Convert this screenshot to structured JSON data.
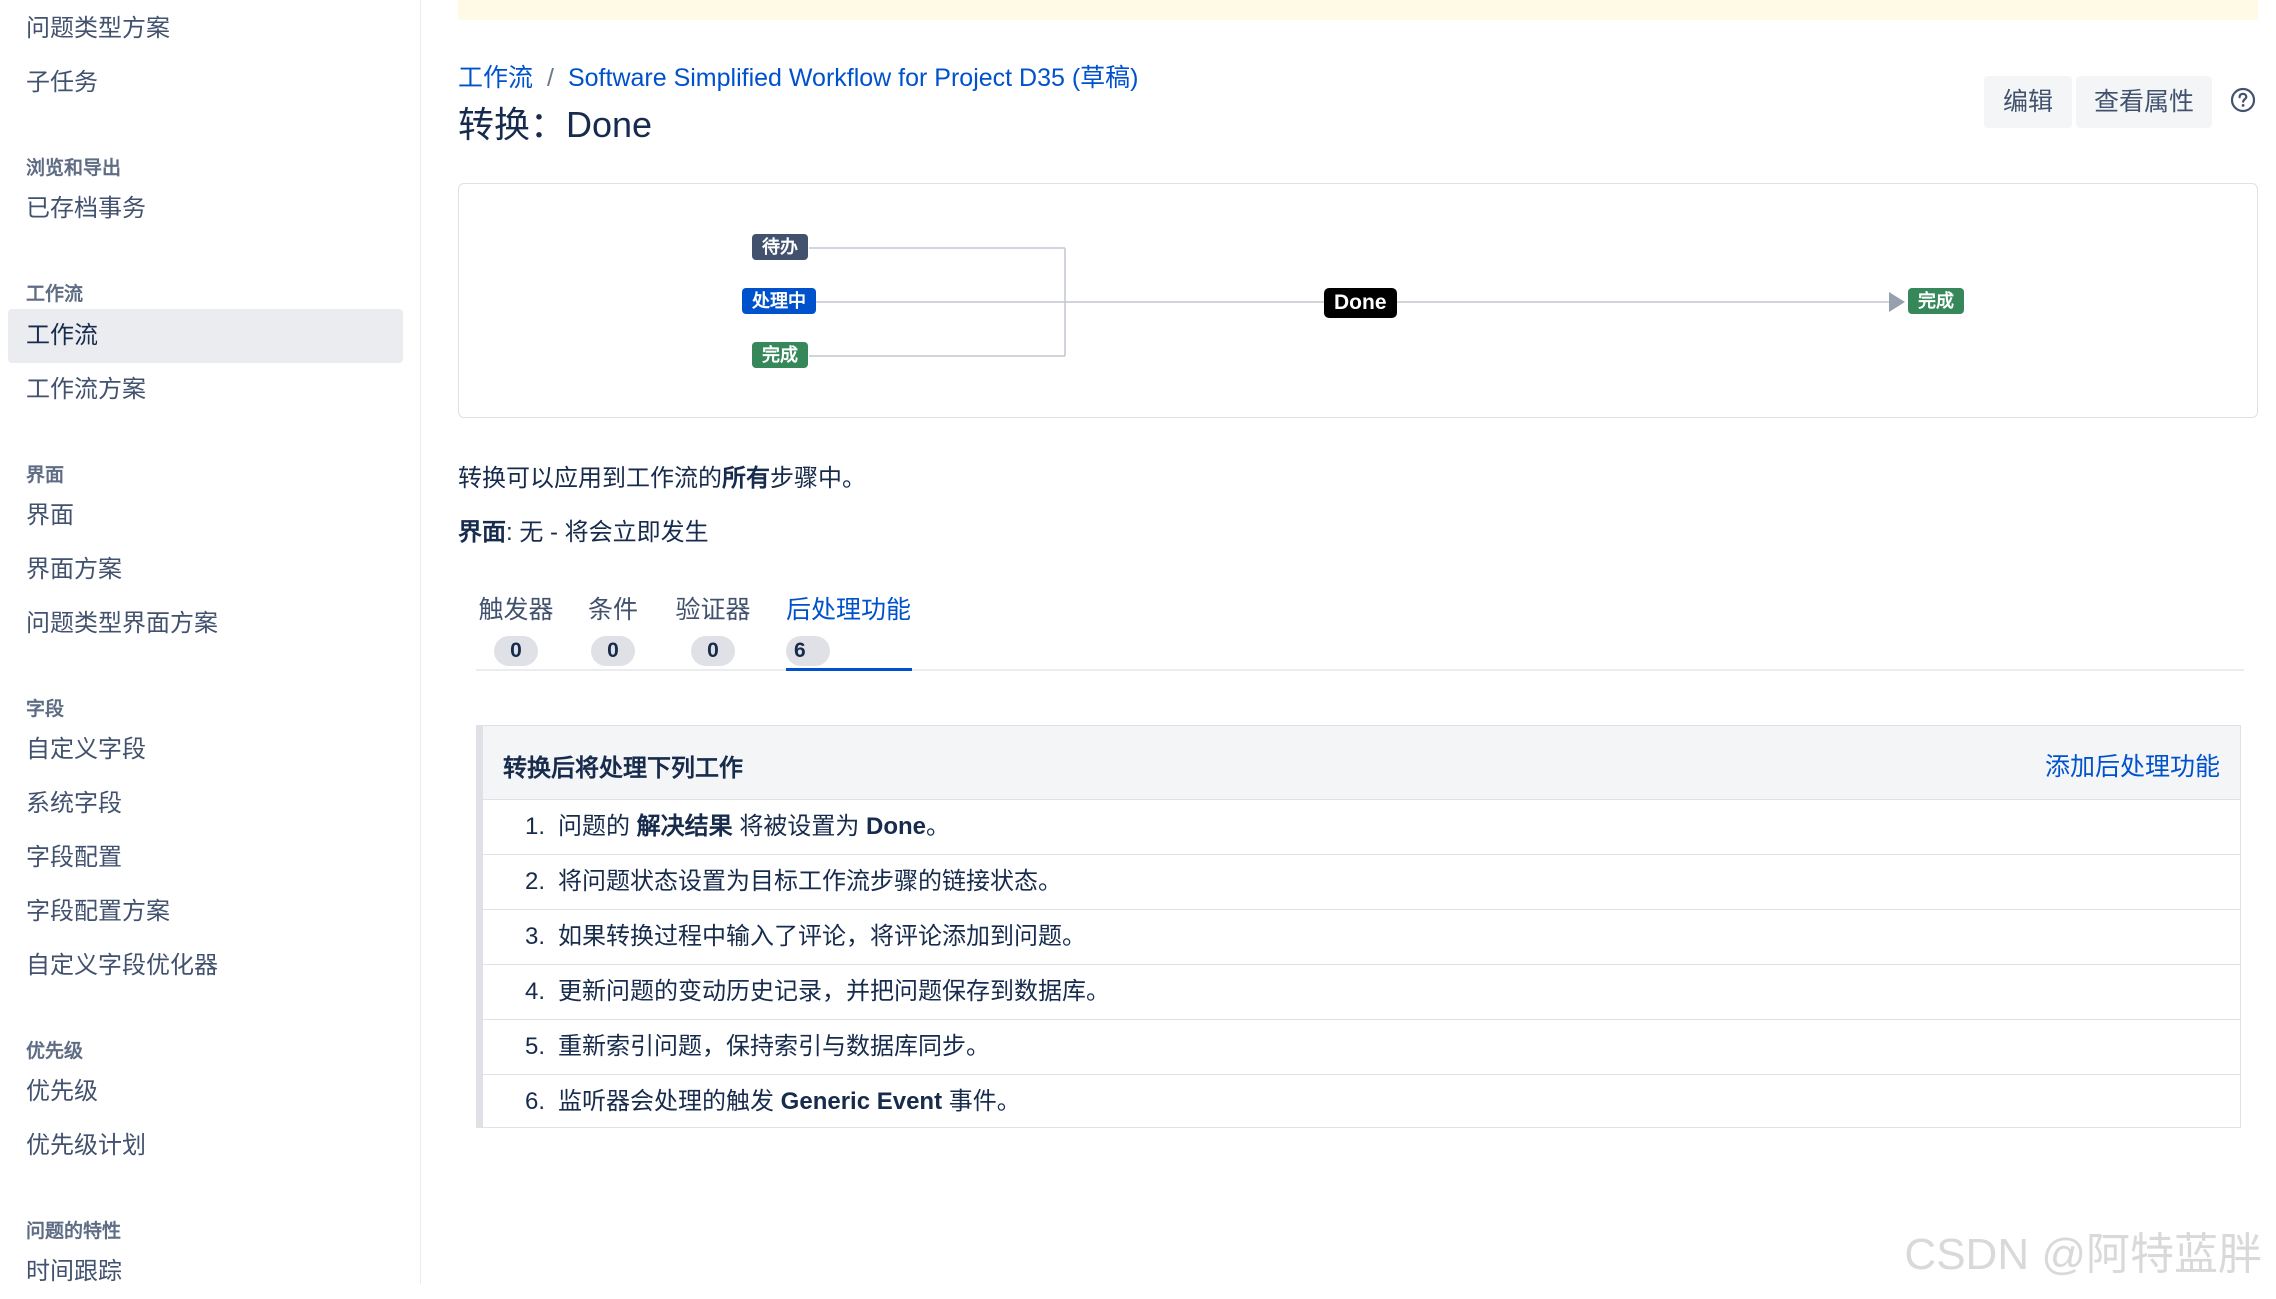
{
  "sidebar": {
    "items": [
      {
        "label": "问题类型方案"
      },
      {
        "label": "子任务"
      },
      {
        "heading": "浏览和导出"
      },
      {
        "label": "已存档事务"
      },
      {
        "heading": "工作流"
      },
      {
        "label": "工作流",
        "active": true
      },
      {
        "label": "工作流方案"
      },
      {
        "heading": "界面"
      },
      {
        "label": "界面"
      },
      {
        "label": "界面方案"
      },
      {
        "label": "问题类型界面方案"
      },
      {
        "heading": "字段"
      },
      {
        "label": "自定义字段"
      },
      {
        "label": "系统字段"
      },
      {
        "label": "字段配置"
      },
      {
        "label": "字段配置方案"
      },
      {
        "label": "自定义字段优化器"
      },
      {
        "heading": "优先级"
      },
      {
        "label": "优先级"
      },
      {
        "label": "优先级计划"
      },
      {
        "heading": "问题的特性"
      },
      {
        "label": "时间跟踪"
      }
    ]
  },
  "breadcrumb": {
    "root": "工作流",
    "separator": "/",
    "current": "Software Simplified Workflow for Project D35 (草稿)"
  },
  "page_title": "转换：Done",
  "actions": {
    "edit": "编辑",
    "view_properties": "查看属性",
    "help_icon": "question-circle-icon"
  },
  "diagram": {
    "sources": [
      {
        "label": "待办",
        "color": "#42526e"
      },
      {
        "label": "处理中",
        "color": "#0052cc"
      },
      {
        "label": "完成",
        "color": "#36875a"
      }
    ],
    "transition": "Done",
    "target": {
      "label": "完成",
      "color": "#36875a"
    }
  },
  "notes": {
    "applies_prefix": "转换可以应用到工作流的",
    "applies_bold": "所有",
    "applies_suffix": "步骤中。",
    "screen_label": "界面",
    "screen_value": ": 无 - 将会立即发生"
  },
  "tabs": [
    {
      "label": "触发器",
      "count": "0"
    },
    {
      "label": "条件",
      "count": "0"
    },
    {
      "label": "验证器",
      "count": "0"
    },
    {
      "label": "后处理功能",
      "count": "6",
      "active": true
    }
  ],
  "post_functions": {
    "title": "转换后将处理下列工作",
    "add_link": "添加后处理功能",
    "items": [
      {
        "num": "1.",
        "pre": "问题的 ",
        "b1": "解决结果",
        "mid": " 将被设置为 ",
        "b2": "Done",
        "post": "。"
      },
      {
        "num": "2.",
        "pre": "将问题状态设置为目标工作流步骤的链接状态。",
        "b1": "",
        "mid": "",
        "b2": "",
        "post": ""
      },
      {
        "num": "3.",
        "pre": "如果转换过程中输入了评论，将评论添加到问题。",
        "b1": "",
        "mid": "",
        "b2": "",
        "post": ""
      },
      {
        "num": "4.",
        "pre": "更新问题的变动历史记录，并把问题保存到数据库。",
        "b1": "",
        "mid": "",
        "b2": "",
        "post": ""
      },
      {
        "num": "5.",
        "pre": "重新索引问题，保持索引与数据库同步。",
        "b1": "",
        "mid": "",
        "b2": "",
        "post": ""
      },
      {
        "num": "6.",
        "pre": "监听器会处理的触发 ",
        "b1": "Generic Event",
        "mid": " 事件。",
        "b2": "",
        "post": ""
      }
    ]
  },
  "watermark": "CSDN @阿特蓝胖"
}
